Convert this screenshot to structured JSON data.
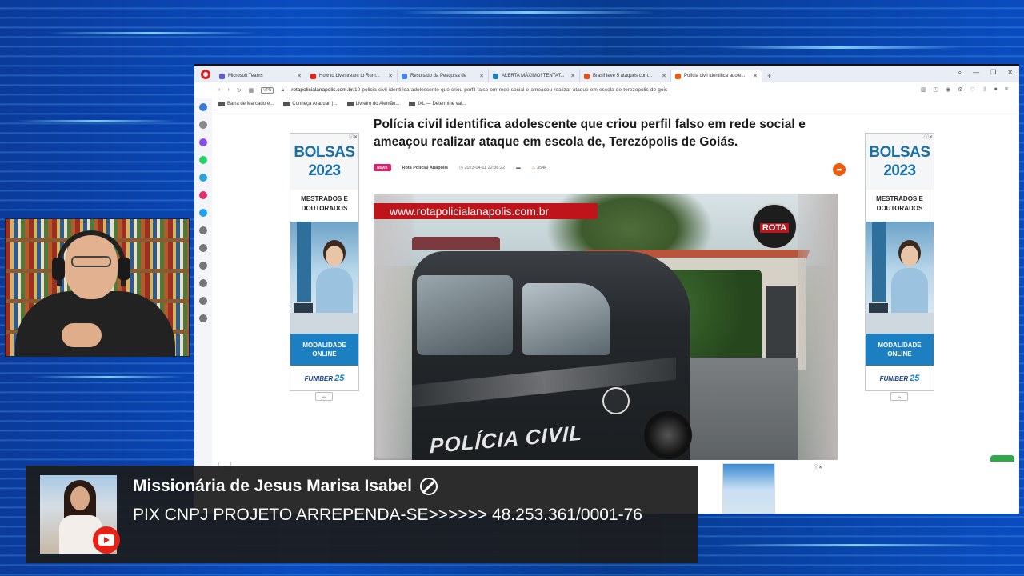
{
  "browser": {
    "tabs": [
      {
        "label": "Microsoft Teams",
        "color": "#5b5fc7"
      },
      {
        "label": "How to Livestream to Rum...",
        "color": "#e62117"
      },
      {
        "label": "Resultado da Pesquisa de",
        "color": "#4285f4"
      },
      {
        "label": "ALERTA MÁXIMO! TENTAT...",
        "color": "#1c7fc2"
      },
      {
        "label": "Brasil teve 5 ataques com...",
        "color": "#e0501b"
      },
      {
        "label": "Polícia civil identifica adole...",
        "color": "#f05a0a"
      }
    ],
    "url_domain": "rotapolicialanapolis.com.br",
    "url_path": "/10-policia-civil-identifica-adolescente-que-criou-perfil-falso-em-rede-social-e-ameacou-realizar-ataque-em-escola-de-terezopolis-de-gois",
    "vpn_label": "VPN",
    "bookmarks": [
      "Barra de Marcadore...",
      "Conheça Araquari |...",
      "Livreiro do Alemão...",
      "IXL — Determine val..."
    ]
  },
  "article": {
    "title": "Polícia civil identifica adolescente que criou perfil falso em rede social e ameaçou realizar ataque em escola de, Terezópolis de Goiás.",
    "badge": "NEWS",
    "author": "Rota Policial Anápolis",
    "datetime": "2023-04-11 22:36:22",
    "views": "354k",
    "watermark": "www.rotapolicialanapolis.com.br",
    "logo_text": "ROTA",
    "car_text": "POLÍCIA CIVIL"
  },
  "ads": {
    "left": {
      "title": "BOLSAS",
      "year": "2023",
      "subtitle1": "MESTRADOS E",
      "subtitle2": "DOUTORADOS",
      "mode1": "MODALIDADE",
      "mode2": "ONLINE",
      "brand": "FUNIBER",
      "brand_num": "25"
    },
    "right": {
      "title": "BOLSAS",
      "year": "2023",
      "subtitle1": "MESTRADOS E",
      "subtitle2": "DOUTORADOS",
      "mode1": "MODALIDADE",
      "mode2": "ONLINE",
      "brand": "FUNIBER",
      "brand_num": "25"
    }
  },
  "lowerthird": {
    "name": "Missionária de Jesus Marisa Isabel",
    "text": "PIX CNPJ PROJETO ARREPENDA-SE>>>>>> 48.253.361/0001-76"
  },
  "sidebar_icons": [
    {
      "name": "home-icon",
      "color": "#3a7bd5"
    },
    {
      "name": "pin-icon",
      "color": "#888888"
    },
    {
      "name": "messenger-icon",
      "color": "#8a4cf0"
    },
    {
      "name": "whatsapp-icon",
      "color": "#25d366"
    },
    {
      "name": "telegram-icon",
      "color": "#2aa3df"
    },
    {
      "name": "instagram-icon",
      "color": "#e1306c"
    },
    {
      "name": "twitter-icon",
      "color": "#1da1f2"
    },
    {
      "name": "player-icon",
      "color": "#777777"
    },
    {
      "name": "send-icon",
      "color": "#777777"
    },
    {
      "name": "heart-icon",
      "color": "#777777"
    },
    {
      "name": "history-icon",
      "color": "#777777"
    },
    {
      "name": "settings-icon",
      "color": "#777777"
    },
    {
      "name": "bulb-icon",
      "color": "#777777"
    }
  ]
}
